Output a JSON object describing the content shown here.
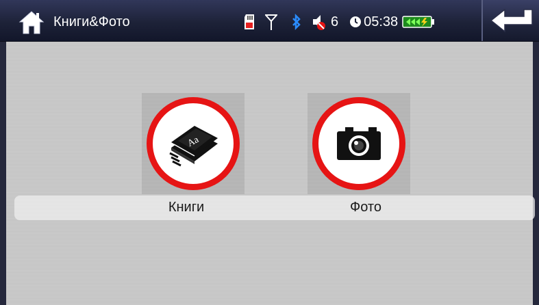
{
  "header": {
    "title": "Книги&Фото",
    "home_icon": "home-icon",
    "back_icon": "back-arrow-icon"
  },
  "status": {
    "icons": [
      "sd-card-icon",
      "antenna-icon",
      "bluetooth-icon",
      "volume-muted-icon",
      "clock-icon",
      "battery-charging-icon"
    ],
    "volume": "6",
    "time": "05:38"
  },
  "apps": [
    {
      "label": "Книги",
      "icon": "book-icon"
    },
    {
      "label": "Фото",
      "icon": "camera-icon"
    }
  ],
  "colors": {
    "accent_red": "#e61414",
    "titlebar": "#1d2238",
    "content_bg": "#c9c9c9",
    "battery_green": "#2ecc2e"
  }
}
